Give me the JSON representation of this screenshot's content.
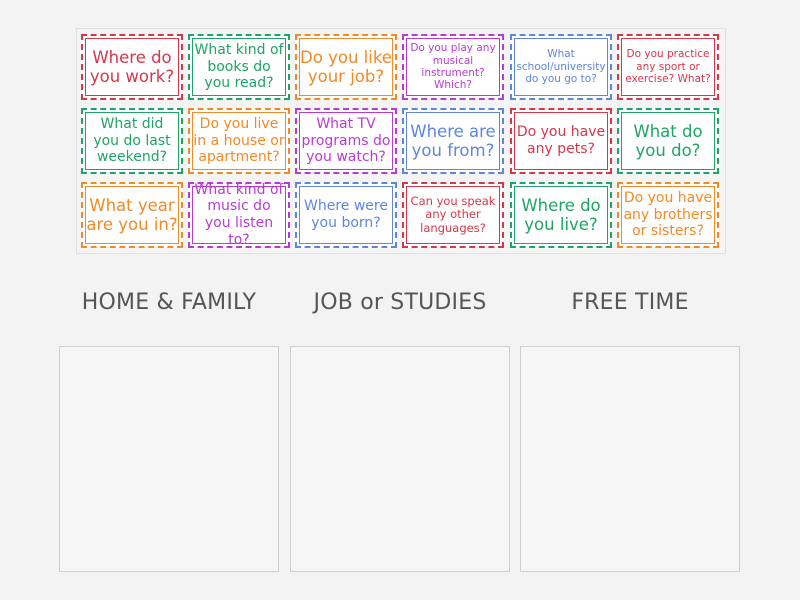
{
  "colors": {
    "red": "#d5374b",
    "green": "#1fa367",
    "orange": "#f28a25",
    "purple": "#b83bd2",
    "blue": "#5f86dc"
  },
  "cards": [
    {
      "text": "Where do you work?",
      "color": "#d5374b"
    },
    {
      "text": "What kind of books do you read?",
      "color": "#1fa367"
    },
    {
      "text": "Do you like your job?",
      "color": "#f28a25"
    },
    {
      "text": "Do you play any musical instrument? Which?",
      "color": "#b83bd2"
    },
    {
      "text": "What school/university do you go to?",
      "color": "#5f86dc"
    },
    {
      "text": "Do you practice any sport or exercise? What?",
      "color": "#d5374b"
    },
    {
      "text": "What did you do last weekend?",
      "color": "#1fa367"
    },
    {
      "text": "Do you live in a house or apartment?",
      "color": "#f28a25"
    },
    {
      "text": "What TV programs do you watch?",
      "color": "#b83bd2"
    },
    {
      "text": "Where are you from?",
      "color": "#5f86dc"
    },
    {
      "text": "Do you have any pets?",
      "color": "#d5374b"
    },
    {
      "text": "What do you do?",
      "color": "#1fa367"
    },
    {
      "text": "What year are you in?",
      "color": "#f28a25"
    },
    {
      "text": "What kind of music do you listen to?",
      "color": "#b83bd2"
    },
    {
      "text": "Where were you born?",
      "color": "#5f86dc"
    },
    {
      "text": "Can you speak any other languages?",
      "color": "#d5374b"
    },
    {
      "text": "Where do you live?",
      "color": "#1fa367"
    },
    {
      "text": "Do you have any brothers or sisters?",
      "color": "#f28a25"
    }
  ],
  "categories": [
    {
      "title": "HOME & FAMILY"
    },
    {
      "title": "JOB or STUDIES"
    },
    {
      "title": "FREE TIME"
    }
  ]
}
